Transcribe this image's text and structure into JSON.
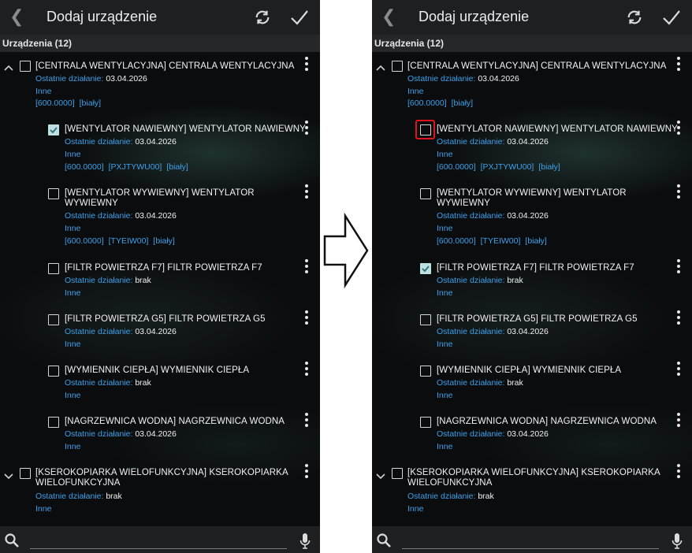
{
  "screens": [
    {
      "header": {
        "title": "Dodaj urządzenie"
      },
      "section_label": "Urządzenia (12)",
      "items": [
        {
          "name": "[CENTRALA WENTYLACYJNA] CENTRALA WENTYLACYJNA",
          "last_label": "Ostatnie działanie:",
          "last_value": "03.04.2026",
          "category": "Inne",
          "tags": [
            "[600.0000]",
            "[biały]"
          ],
          "checked": false
        },
        {
          "name": "[WENTYLATOR NAWIEWNY] WENTYLATOR NAWIEWNY",
          "last_label": "Ostatnie działanie:",
          "last_value": "03.04.2026",
          "category": "Inne",
          "tags": [
            "[600.0000]",
            "[PXJTYWU00]",
            "[biały]"
          ],
          "checked": true
        },
        {
          "name_line1": "[WENTYLATOR WYWIEWNY] WENTYLATOR",
          "name_line2": "WYWIEWNY",
          "last_label": "Ostatnie działanie:",
          "last_value": "03.04.2026",
          "category": "Inne",
          "tags": [
            "[600.0000]",
            "[TYEIW00]",
            "[biały]"
          ],
          "checked": false
        },
        {
          "name": "[FILTR POWIETRZA F7] FILTR POWIETRZA F7",
          "last_label": "Ostatnie działanie:",
          "last_value": "brak",
          "category": "Inne",
          "checked": false
        },
        {
          "name": "[FILTR POWIETRZA G5] FILTR POWIETRZA G5",
          "last_label": "Ostatnie działanie:",
          "last_value": "03.04.2026",
          "category": "Inne",
          "checked": false
        },
        {
          "name": "[WYMIENNIK CIEPŁA] WYMIENNIK CIEPŁA",
          "last_label": "Ostatnie działanie:",
          "last_value": "brak",
          "category": "Inne",
          "checked": false
        },
        {
          "name": "[NAGRZEWNICA WODNA] NAGRZEWNICA WODNA",
          "last_label": "Ostatnie działanie:",
          "last_value": "03.04.2026",
          "category": "Inne",
          "checked": false
        },
        {
          "name_line1": "[KSEROKOPIARKA WIELOFUNKCYJNA] KSEROKOPIARKA",
          "name_line2": "WIELOFUNKCYJNA",
          "last_label": "Ostatnie działanie:",
          "last_value": "brak",
          "category": "Inne",
          "checked": false
        }
      ]
    },
    {
      "header": {
        "title": "Dodaj urządzenie"
      },
      "section_label": "Urządzenia (12)",
      "items": [
        {
          "name": "[CENTRALA WENTYLACYJNA] CENTRALA WENTYLACYJNA",
          "last_label": "Ostatnie działanie:",
          "last_value": "03.04.2026",
          "category": "Inne",
          "tags": [
            "[600.0000]",
            "[biały]"
          ],
          "checked": false
        },
        {
          "name": "[WENTYLATOR NAWIEWNY] WENTYLATOR NAWIEWNY",
          "last_label": "Ostatnie działanie:",
          "last_value": "03.04.2026",
          "category": "Inne",
          "tags": [
            "[600.0000]",
            "[PXJTYWU00]",
            "[biały]"
          ],
          "checked": false
        },
        {
          "name_line1": "[WENTYLATOR WYWIEWNY] WENTYLATOR",
          "name_line2": "WYWIEWNY",
          "last_label": "Ostatnie działanie:",
          "last_value": "03.04.2026",
          "category": "Inne",
          "tags": [
            "[600.0000]",
            "[TYEIW00]",
            "[biały]"
          ],
          "checked": false
        },
        {
          "name": "[FILTR POWIETRZA F7] FILTR POWIETRZA F7",
          "last_label": "Ostatnie działanie:",
          "last_value": "brak",
          "category": "Inne",
          "checked": true
        },
        {
          "name": "[FILTR POWIETRZA G5] FILTR POWIETRZA G5",
          "last_label": "Ostatnie działanie:",
          "last_value": "03.04.2026",
          "category": "Inne",
          "checked": false
        },
        {
          "name": "[WYMIENNIK CIEPŁA] WYMIENNIK CIEPŁA",
          "last_label": "Ostatnie działanie:",
          "last_value": "brak",
          "category": "Inne",
          "checked": false
        },
        {
          "name": "[NAGRZEWNICA WODNA] NAGRZEWNICA WODNA",
          "last_label": "Ostatnie działanie:",
          "last_value": "03.04.2026",
          "category": "Inne",
          "checked": false
        },
        {
          "name_line1": "[KSEROKOPIARKA WIELOFUNKCYJNA] KSEROKOPIARKA",
          "name_line2": "WIELOFUNKCYJNA",
          "last_label": "Ostatnie działanie:",
          "last_value": "brak",
          "category": "Inne",
          "checked": false
        }
      ]
    }
  ],
  "icons": {
    "back": "back-chevron-icon",
    "refresh": "refresh-icon",
    "confirm": "check-icon",
    "search": "search-icon",
    "mic": "microphone-icon",
    "more": "more-vertical-icon",
    "arrow": "right-arrow-icon"
  },
  "colors": {
    "accent_blue": "#3da1ec",
    "check_fill": "#bfe0e3",
    "highlight_red": "#e0121b",
    "bar_bg": "#1e1f21"
  }
}
